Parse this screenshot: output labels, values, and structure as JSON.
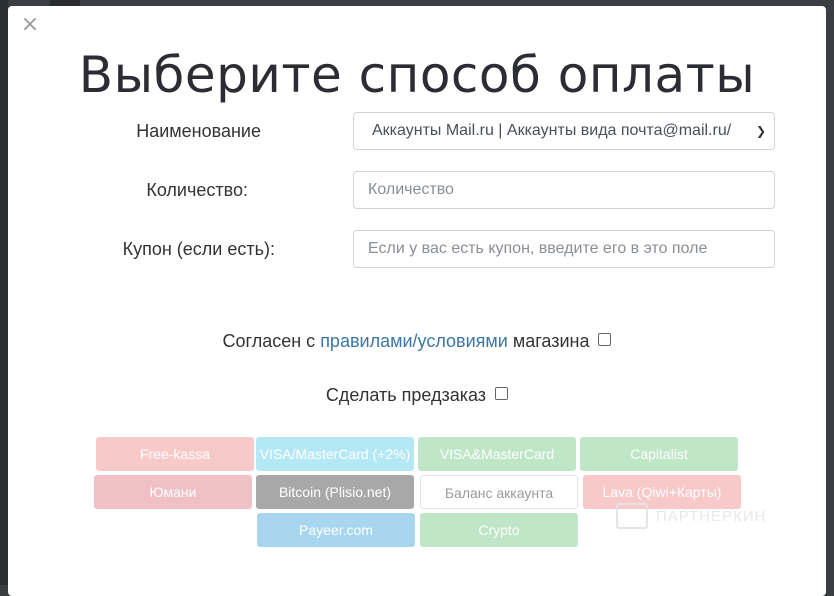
{
  "modal": {
    "close_glyph": "×",
    "title": "Выберите способ оплаты"
  },
  "form": {
    "name_label": "Наименование",
    "name_value": "Аккаунты Mail.ru | Аккаунты вида почта@mail.ru/",
    "qty_label": "Количество:",
    "qty_placeholder": "Количество",
    "coupon_label": "Купон (если есть):",
    "coupon_placeholder": "Если у вас есть купон, введите его в это поле"
  },
  "agree": {
    "prefix": "Согласен с ",
    "link": "правилами/условиями",
    "suffix": " магазина"
  },
  "preorder_label": "Сделать предзаказ",
  "payment_methods": [
    {
      "label": "Free-kassa",
      "color": "#f7c9c9"
    },
    {
      "label": "VISA/MasterCard (+2%)",
      "color": "#b5e8f5"
    },
    {
      "label": "VISA&MasterCard",
      "color": "#bfe6c7"
    },
    {
      "label": "Capitalist",
      "color": "#bfe6c7"
    },
    {
      "label": "Юмани",
      "color": "#efc0c4"
    },
    {
      "label": "Bitcoin (Plisio.net)",
      "color": "#a8a8a8"
    },
    {
      "label": "Баланс аккаунта",
      "color": "#ffffff"
    },
    {
      "label": "Lava (Qiwi+Карты)",
      "color": "#f7c9c9"
    },
    {
      "label": "Payeer.com",
      "color": "#a9d6ef"
    },
    {
      "label": "Crypto",
      "color": "#bfe6c7"
    }
  ],
  "watermark": "ПАРТНЕРКИН"
}
